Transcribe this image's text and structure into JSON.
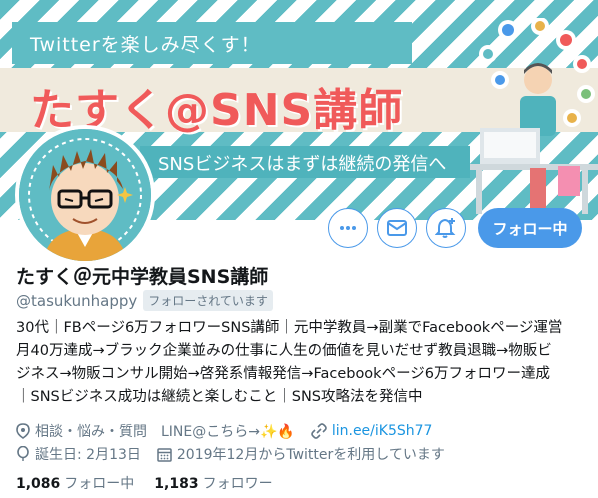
{
  "banner": {
    "tagline": "Twitterを楽しみ尽くす！",
    "title": "たすく@SNS講師",
    "subtitle": "SNSビジネスはまずは継続の発信へ"
  },
  "actions": {
    "follow_label": "フォロー中"
  },
  "profile": {
    "name": "たすく＠元中学教員SNS講師",
    "handle": "@tasukunhappy",
    "follows_you": "フォローされています",
    "bio_lines": [
      "30代｜FBページ6万フォロワーSNS講師｜元中学教員→副業でFacebookページ運営",
      "月40万達成→ブラック企業並みの仕事に人生の価値を見いだせず教員退職→物販ビ",
      "ジネス→物販コンサル開始→啓発系情報発信→Facebookページ6万フォロワー達成",
      "｜SNSビジネス成功は継続と楽しむこと｜SNS攻略法を発信中"
    ],
    "location": "相談・悩み・質問　LINE@こちら→✨🔥",
    "url": "lin.ee/iK5Sh77",
    "birthday": "誕生日: 2月13日",
    "joined": "2019年12月からTwitterを利用しています"
  },
  "stats": {
    "following_count": "1,086",
    "following_label": "フォロー中",
    "followers_count": "1,183",
    "followers_label": "フォロワー"
  },
  "colors": {
    "accent": "#4a99e9",
    "banner_teal": "#5fbcc4",
    "banner_title": "#f05a5a",
    "link": "#1b95e0",
    "secondary_text": "#657786"
  }
}
